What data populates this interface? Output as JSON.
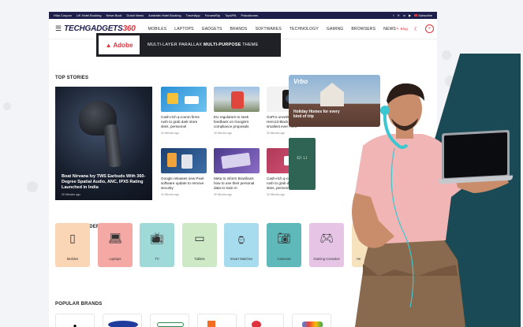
{
  "topbar": {
    "links": [
      "Hilai Coupon",
      "UK Hotel Booking",
      "News Buck",
      "Dutch News",
      "Australia Hotel Booking",
      "TravelApp",
      "FunandSip",
      "TopUPA",
      "Pokiokiones"
    ],
    "subscribe_label": "Subscribe"
  },
  "header": {
    "logo_main": "TECHGADGETS",
    "logo_accent": "360",
    "nav": [
      "MOBILES",
      "LAPTOPS",
      "GADGETS",
      "BRANDS",
      "SOFTWARES",
      "TECHNOLOGY",
      "GAMING",
      "BROWSERS",
      "NEWS"
    ],
    "blog_label": "Blog"
  },
  "banner": {
    "brand": "Adobe",
    "text_prefix": "MULTI-LAYER PARALLAX ",
    "text_bold": "MULTI-PURPOSE",
    "text_suffix": " THEME"
  },
  "top_stories": {
    "title": "TOP STORIES",
    "hero": {
      "title": "Boat Nirvana Ivy TWS Earbuds With 360-Degree Spatial Audio, ANC, IPX5 Rating Launched in India",
      "time": "30 Minutes ago"
    },
    "cards": [
      {
        "title": "Cash-rich q-comm firms rush to grab dark store sites, personnel",
        "time": "30 Minutes ago"
      },
      {
        "title": "EU regulators to seek feedback on Google's compliance proposals",
        "time": "30 Minutes ago"
      },
      {
        "title": "GoPro unveils flagship Hero13 Black and its smallest ever Hero",
        "time": "30 Minutes ago"
      },
      {
        "title": "Google releases new Pixel software update to remove security",
        "time": "30 Minutes ago"
      },
      {
        "title": "Meta to inform Brazilians how to use their personal data to train AI",
        "time": "30 Minutes ago"
      },
      {
        "title": "Cash-rich q-comm firms rush to grab dark store sites, personnel",
        "time": "30 Minutes ago"
      }
    ],
    "ad_brand": "Vrbo",
    "ad_caption": "Holiday Homes for every kind of trip",
    "ad_side_text": "GI LI"
  },
  "product_finder": {
    "title": "PRODUCT FINDER",
    "items": [
      {
        "label": "Mobiles",
        "icon": "mobile-icon",
        "color": "#fbd6b6"
      },
      {
        "label": "Laptops",
        "icon": "laptop-icon",
        "color": "#f5a9a5"
      },
      {
        "label": "TV",
        "icon": "tv-icon",
        "color": "#9fd9d8"
      },
      {
        "label": "Tablets",
        "icon": "tablet-icon",
        "color": "#cde9c6"
      },
      {
        "label": "Smart Watches",
        "icon": "watch-icon",
        "color": "#a7dcef"
      },
      {
        "label": "Cameras",
        "icon": "camera-icon",
        "color": "#5fb9ba"
      },
      {
        "label": "Gaming Consoles",
        "icon": "console-icon",
        "color": "#e5c4e6"
      },
      {
        "label": "He",
        "icon": "headphone-icon",
        "color": "#f6e2bd"
      }
    ]
  },
  "popular_brands": {
    "title": "POPULAR BRANDS"
  },
  "colors": {
    "topbar": "#1d1e4a",
    "accent": "#e0323c",
    "teal_shape": "#1a4a55"
  }
}
